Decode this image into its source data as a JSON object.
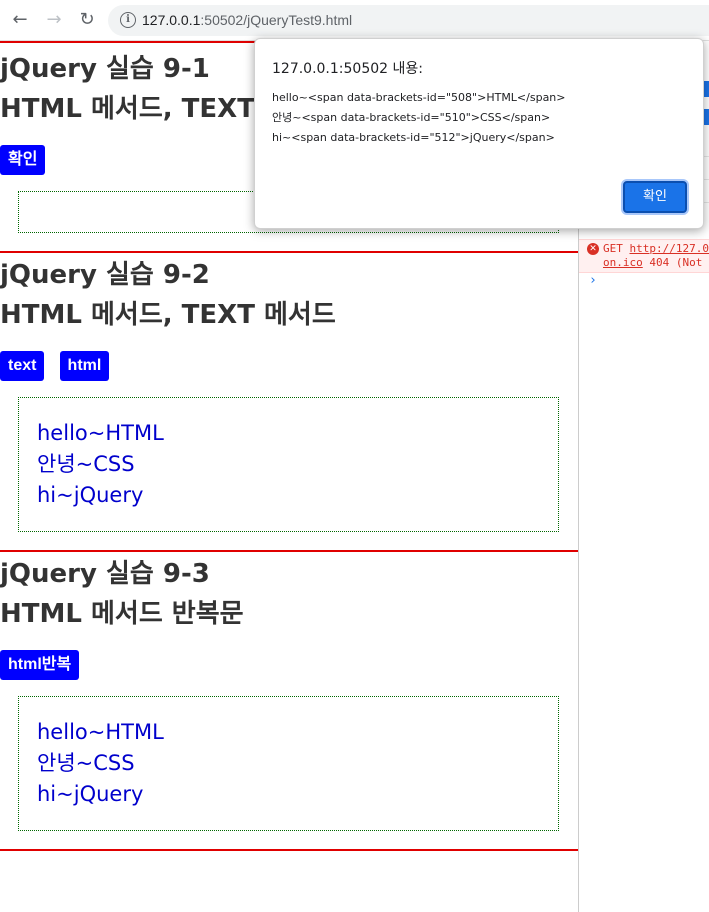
{
  "browser": {
    "back_glyph": "←",
    "forward_glyph": "→",
    "reload_glyph": "↻",
    "info_glyph": "i",
    "url_host": "127.0.0.1",
    "url_rest": ":50502/jQueryTest9.html"
  },
  "sections": [
    {
      "title_line1": "jQuery 실습 9-1",
      "title_line2": "HTML 메서드, TEXT 메서드",
      "buttons": [
        "확인"
      ],
      "lines": []
    },
    {
      "title_line1": "jQuery 실습 9-2",
      "title_line2": "HTML 메서드, TEXT 메서드",
      "buttons": [
        "text",
        "html"
      ],
      "lines": [
        "hello~HTML",
        "안녕~CSS",
        "hi~jQuery"
      ]
    },
    {
      "title_line1": "jQuery 실습 9-3",
      "title_line2": "HTML 메서드 반복문",
      "buttons": [
        "html반복"
      ],
      "lines": [
        "hello~HTML",
        "안녕~CSS",
        "hi~jQuery"
      ]
    }
  ],
  "dialog": {
    "origin": "127.0.0.1:50502 내용:",
    "messages": [
      "hello~<span data-brackets-id=\"508\">HTML</span>",
      "안녕~<span data-brackets-id=\"510\">CSS</span>",
      "hi~<span data-brackets-id=\"512\">jQuery</span>"
    ],
    "ok_label": "확인"
  },
  "devtools": {
    "error_icon": "x-circle-icon",
    "error_method": "GET",
    "error_url_start": "http://127.0",
    "error_url_end": "on.ico",
    "error_status": "404 (Not",
    "prompt": "›"
  },
  "colors": {
    "accent_red": "#e00000",
    "button_blue": "#0000ff",
    "result_text": "#0000cc",
    "dialog_ok": "#1a73e8"
  }
}
